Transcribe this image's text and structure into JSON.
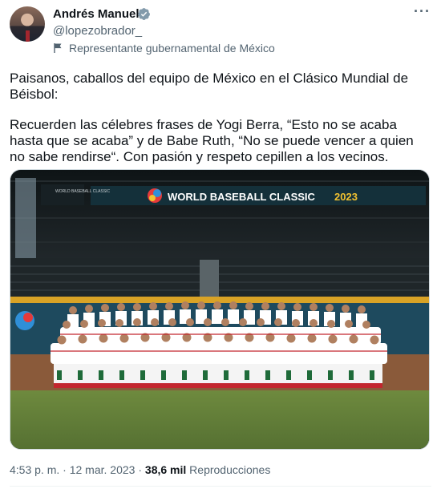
{
  "author": {
    "name": "Andrés Manuel",
    "handle": "@lopezobrador_",
    "label": "Representante gubernamental de México",
    "avatar_icon": "avatar-portrait",
    "verified_icon": "verified-badge-icon"
  },
  "tweet": {
    "paragraph1": "Paisanos, caballos del equipo de México en el Clásico Mundial de Béisbol:",
    "paragraph2": "Recuerden las célebres frases de Yogi Berra, “Esto no se acaba hasta que se acaba” y de Babe Ruth, “No se puede vencer a quien no sabe rendirse“. Con pasión y respeto cepillen a los vecinos."
  },
  "image": {
    "banner_text": "WORLD BASEBALL CLASSIC",
    "banner_year": "2023",
    "small_logo_text": "WORLD BASEBALL CLASSIC"
  },
  "meta": {
    "time": "4:53 p. m.",
    "separator": " · ",
    "date": "12 mar. 2023",
    "views_count": "38,6 mil",
    "views_label": "Reproducciones"
  },
  "colors": {
    "text_primary": "#0f1419",
    "text_secondary": "#536471",
    "verified": "#829aab",
    "banner_bg": "#14303a",
    "year_yellow": "#f2c230"
  }
}
